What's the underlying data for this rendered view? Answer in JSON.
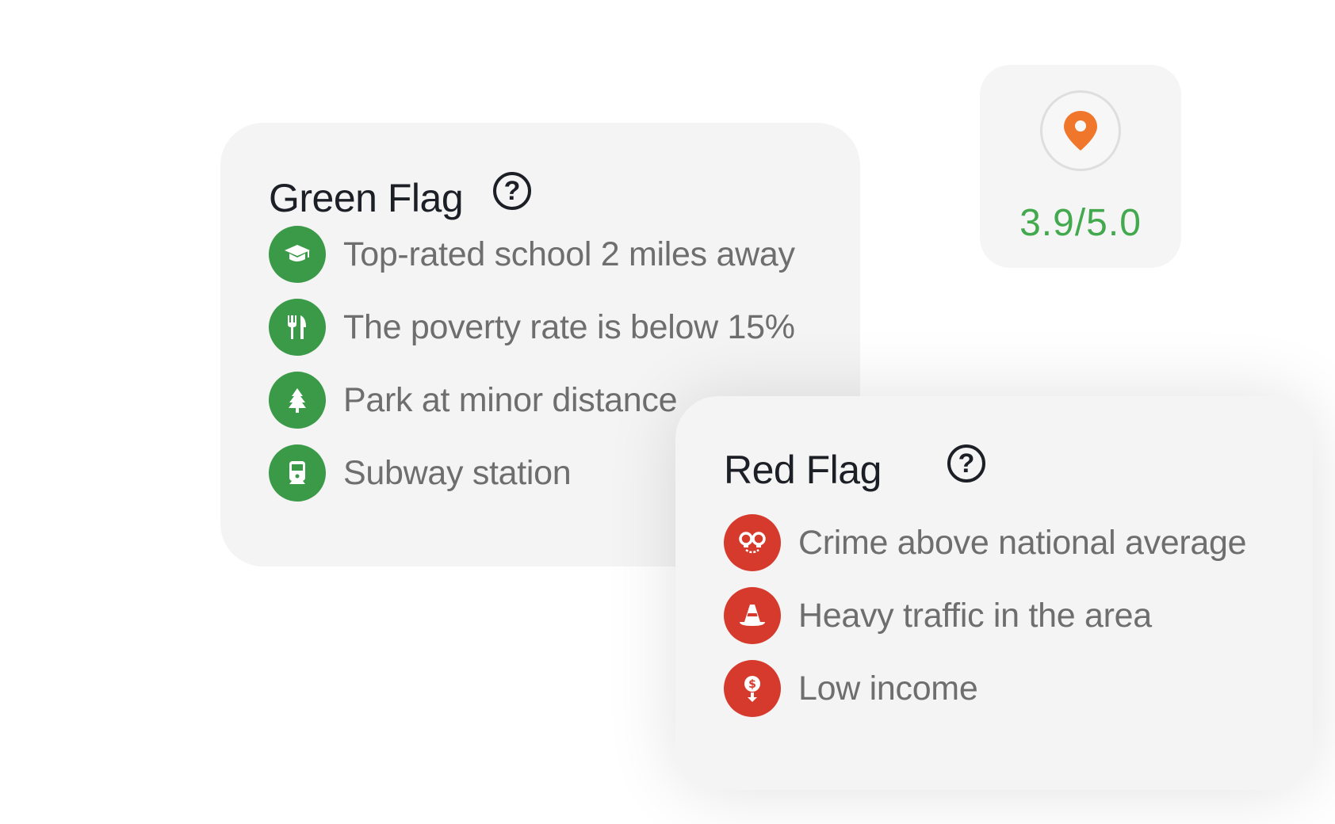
{
  "green_flag": {
    "title": "Green Flag",
    "help_symbol": "?",
    "accent_color": "#3b9a48",
    "items": [
      {
        "label": "Top-rated school 2 miles away",
        "icon": "graduation-cap-icon"
      },
      {
        "label": "The poverty rate is below 15%",
        "icon": "fork-knife-icon"
      },
      {
        "label": "Park at minor distance",
        "icon": "tree-icon"
      },
      {
        "label": "Subway station",
        "icon": "train-icon"
      }
    ]
  },
  "red_flag": {
    "title": "Red Flag",
    "help_symbol": "?",
    "accent_color": "#d63a2d",
    "items": [
      {
        "label": "Crime above national average",
        "icon": "handcuffs-icon"
      },
      {
        "label": "Heavy traffic in the area",
        "icon": "traffic-cone-icon"
      },
      {
        "label": "Low income",
        "icon": "income-down-icon"
      }
    ]
  },
  "rating": {
    "score_text": "3.9/5.0",
    "icon": "location-pin-icon",
    "pin_color": "#f0762b",
    "score_color": "#43a94f"
  }
}
